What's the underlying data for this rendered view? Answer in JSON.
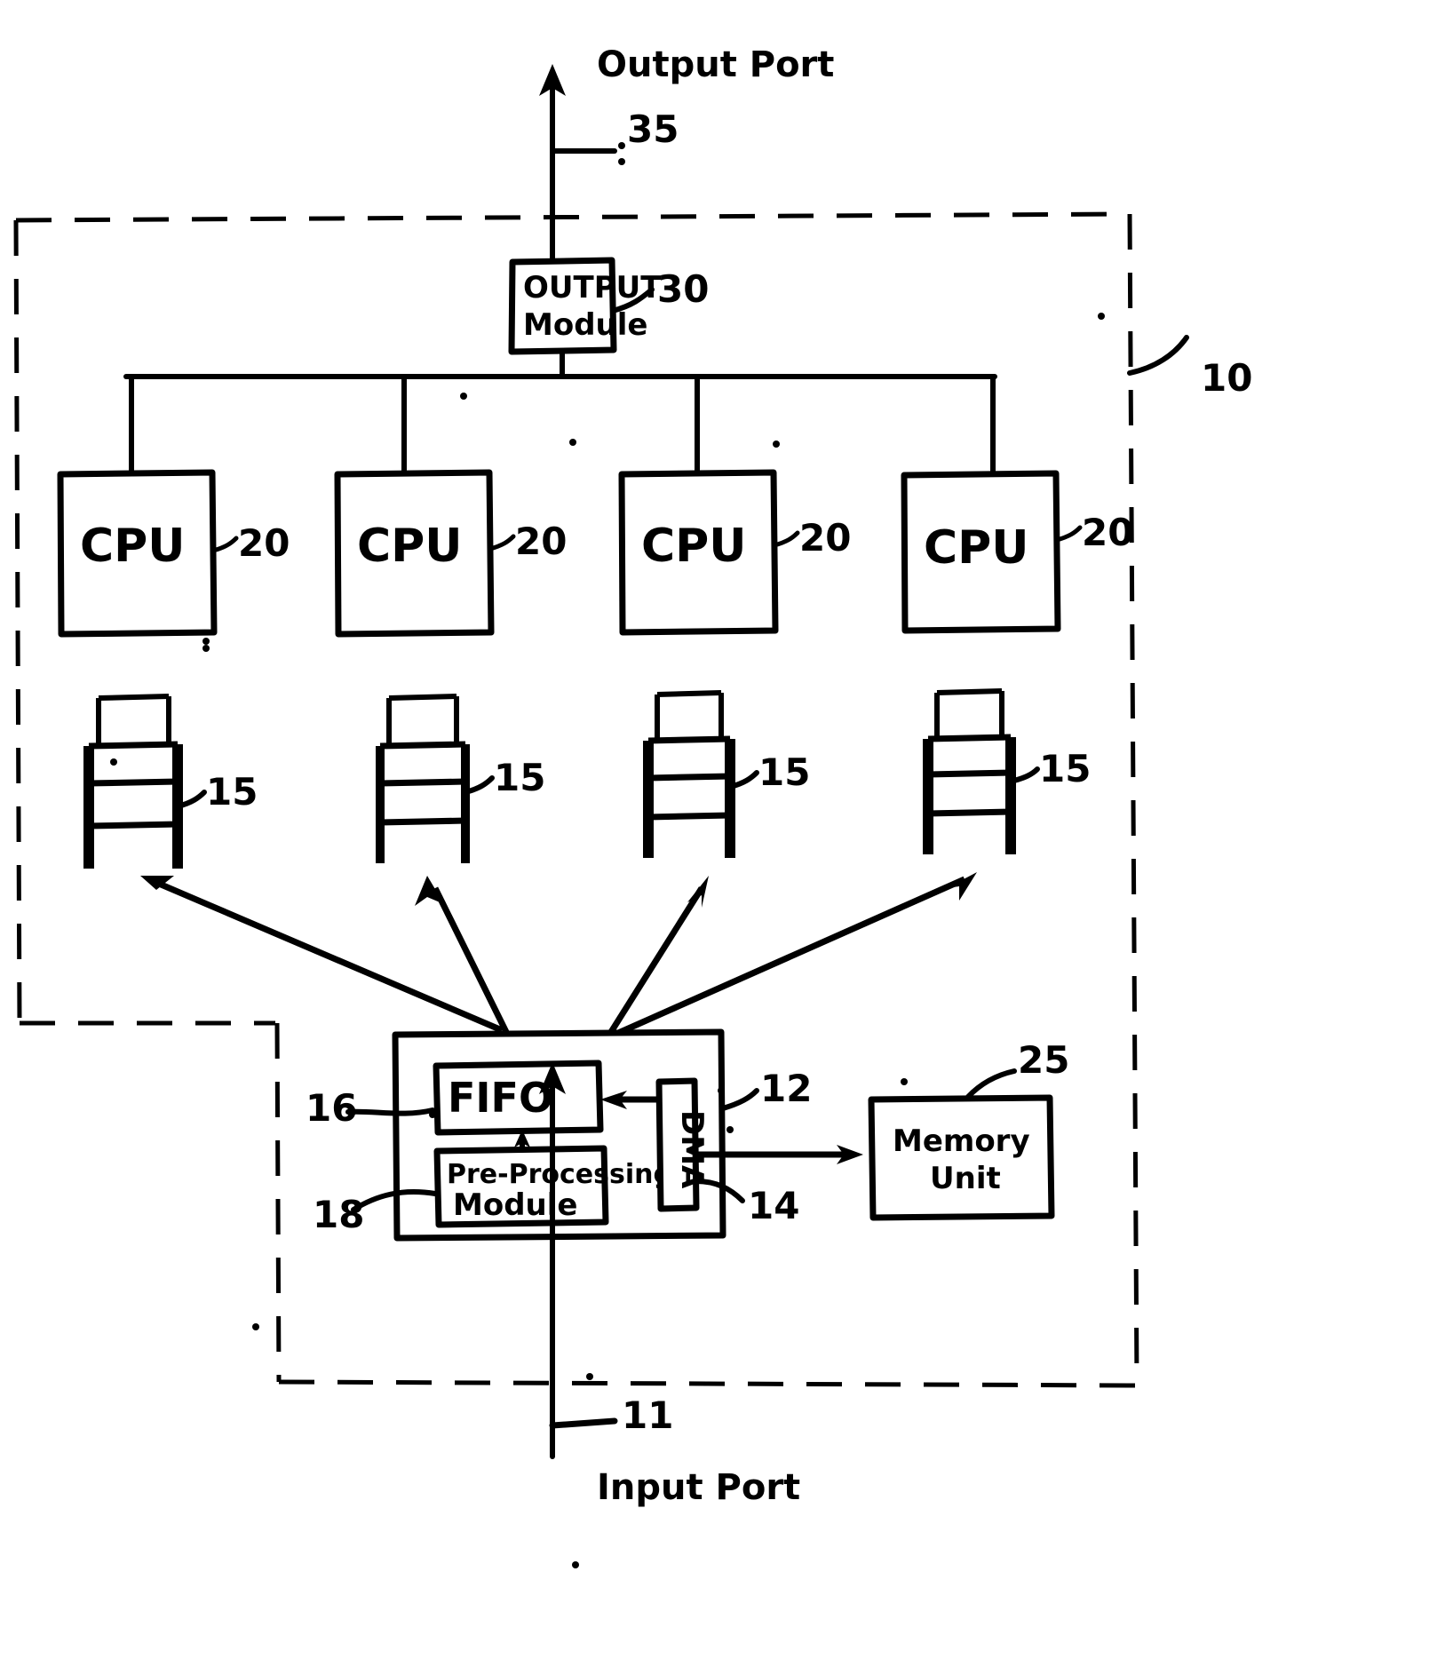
{
  "figure": {
    "kind": "patent-diagram",
    "style": "hand-drawn black ink on white",
    "ink_color": "#000000",
    "background_color": "#ffffff"
  },
  "labels": {
    "output_port": "Output Port",
    "input_port": "Input Port",
    "system_ref": "10",
    "output_port_ref": "35",
    "input_port_ref": "11"
  },
  "output_module": {
    "line1": "OUTPUT",
    "line2": "Module",
    "ref": "30"
  },
  "cpus": [
    {
      "label": "CPU",
      "ref": "20"
    },
    {
      "label": "CPU",
      "ref": "20"
    },
    {
      "label": "CPU",
      "ref": "20"
    },
    {
      "label": "CPU",
      "ref": "20"
    }
  ],
  "queues": [
    {
      "ref": "15"
    },
    {
      "ref": "15"
    },
    {
      "ref": "15"
    },
    {
      "ref": "15"
    }
  ],
  "input_unit": {
    "ref": "12",
    "fifo": {
      "label": "FIFO",
      "ref": "16"
    },
    "preprocessing": {
      "line1": "Pre-Processing",
      "line2": "Module",
      "ref": "18"
    },
    "dma": {
      "label": "DMA",
      "ref": "14"
    }
  },
  "memory_unit": {
    "line1": "Memory",
    "line2": "Unit",
    "ref": "25"
  }
}
